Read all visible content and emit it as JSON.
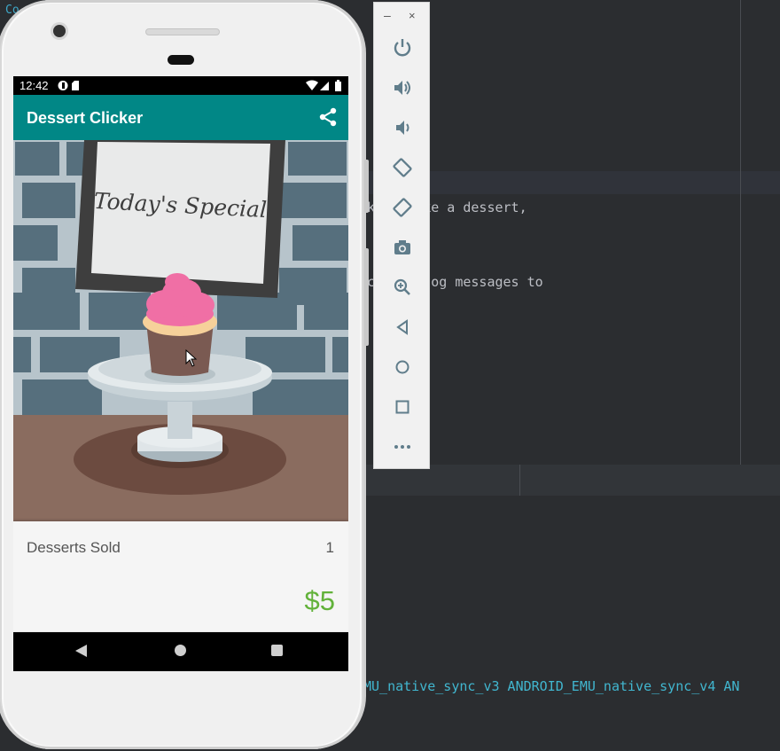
{
  "ide": {
    "corner_text": "Co",
    "code_lines": [
      "k    make a dessert,",
      "c   nd log messages to",
      "MU_native_sync_v3 ANDROID_EMU_native_sync_v4 AN"
    ]
  },
  "phone": {
    "status_time": "12:42",
    "app_title": "Dessert Clicker",
    "sign_text": "Today's Special",
    "desserts_sold_label": "Desserts Sold",
    "desserts_sold_count": "1",
    "revenue": "$5"
  },
  "icons": {
    "share": "share-icon",
    "nav": [
      "nav-back-icon",
      "nav-home-icon",
      "nav-recents-icon"
    ]
  },
  "toolbar": {
    "minimize": "–",
    "close": "×",
    "buttons": [
      "power-icon",
      "volume-up-icon",
      "volume-down-icon",
      "rotate-left-icon",
      "rotate-right-icon",
      "camera-icon",
      "zoom-icon",
      "back-icon",
      "home-icon",
      "overview-icon",
      "more-icon"
    ]
  },
  "colors": {
    "app_bar": "#018786",
    "revenue": "#62b23a",
    "frosting": "#f06fa5"
  }
}
